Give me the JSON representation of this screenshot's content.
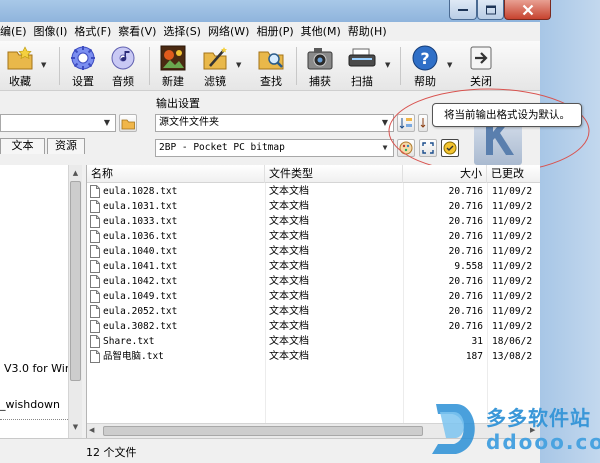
{
  "menu": [
    "编(E)",
    "图像(I)",
    "格式(F)",
    "察看(V)",
    "选择(S)",
    "网络(W)",
    "相册(P)",
    "其他(M)",
    "帮助(H)"
  ],
  "toolbar": {
    "collect": "收藏",
    "settings": "设置",
    "sound": "音频",
    "new": "新建",
    "filter": "滤镜",
    "find": "查找",
    "capture": "捕获",
    "scan": "扫描",
    "help": "帮助",
    "close": "关闭"
  },
  "output": {
    "label": "输出设置",
    "folder": "源文件文件夹",
    "format": "2BP - Pocket PC bitmap"
  },
  "left_tabs": [
    "文本",
    "资源"
  ],
  "left_items": [
    "V3.0 for Wir",
    "_wishdown"
  ],
  "tooltip": "将当前输出格式设为默认。",
  "columns": {
    "name": "名称",
    "type": "文件类型",
    "size": "大小",
    "modified": "已更改"
  },
  "files": [
    {
      "name": "eula.1028.txt",
      "type": "文本文档",
      "size": "20.716",
      "modified": "11/09/2"
    },
    {
      "name": "eula.1031.txt",
      "type": "文本文档",
      "size": "20.716",
      "modified": "11/09/2"
    },
    {
      "name": "eula.1033.txt",
      "type": "文本文档",
      "size": "20.716",
      "modified": "11/09/2"
    },
    {
      "name": "eula.1036.txt",
      "type": "文本文档",
      "size": "20.716",
      "modified": "11/09/2"
    },
    {
      "name": "eula.1040.txt",
      "type": "文本文档",
      "size": "20.716",
      "modified": "11/09/2"
    },
    {
      "name": "eula.1041.txt",
      "type": "文本文档",
      "size": "9.558",
      "modified": "11/09/2"
    },
    {
      "name": "eula.1042.txt",
      "type": "文本文档",
      "size": "20.716",
      "modified": "11/09/2"
    },
    {
      "name": "eula.1049.txt",
      "type": "文本文档",
      "size": "20.716",
      "modified": "11/09/2"
    },
    {
      "name": "eula.2052.txt",
      "type": "文本文档",
      "size": "20.716",
      "modified": "11/09/2"
    },
    {
      "name": "eula.3082.txt",
      "type": "文本文档",
      "size": "20.716",
      "modified": "11/09/2"
    },
    {
      "name": "Share.txt",
      "type": "文本文档",
      "size": "31",
      "modified": "18/06/2"
    },
    {
      "name": "品智电脑.txt",
      "type": "文本文档",
      "size": "187",
      "modified": "13/08/2"
    }
  ],
  "status": "12 个文件",
  "watermark": {
    "brand": "多多软件站",
    "url": "ddooo.com"
  }
}
